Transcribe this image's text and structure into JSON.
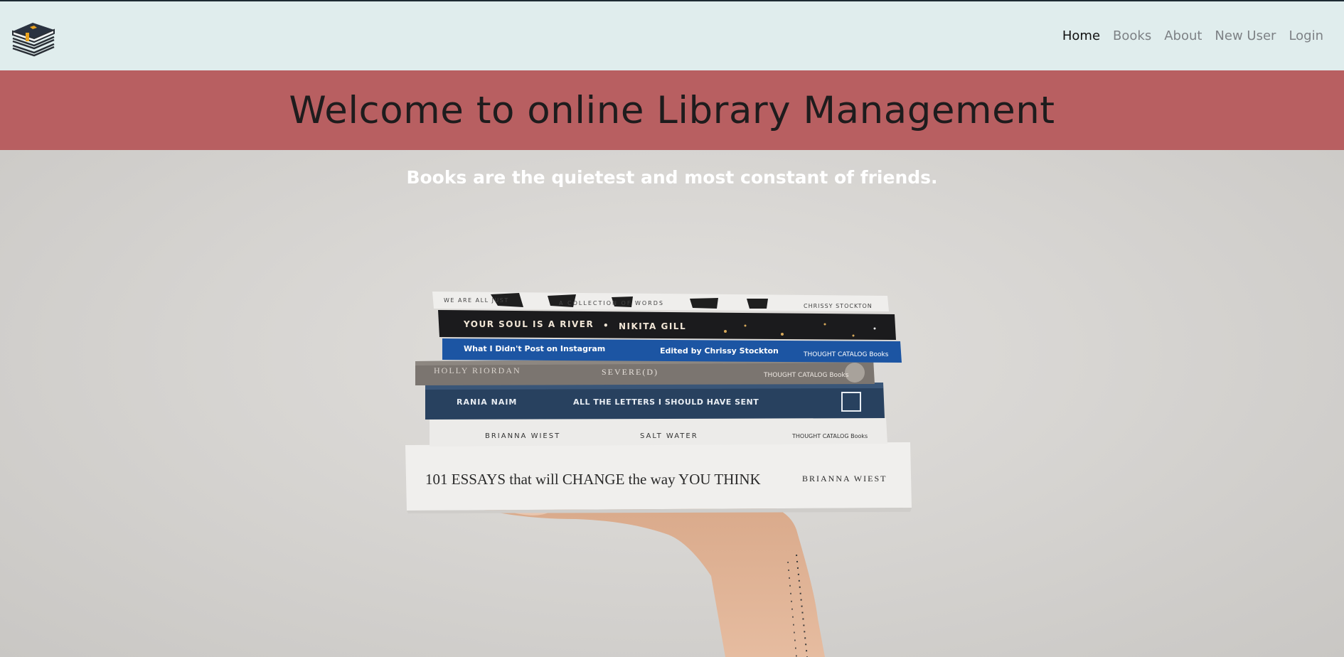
{
  "navbar": {
    "logo_icon": "stacked-books-icon",
    "links": [
      {
        "label": "Home",
        "active": true
      },
      {
        "label": "Books",
        "active": false
      },
      {
        "label": "About",
        "active": false
      },
      {
        "label": "New User",
        "active": false
      },
      {
        "label": "Login",
        "active": false
      }
    ]
  },
  "hero": {
    "title": "Welcome to online Library Management",
    "subtitle": "Books are the quietest and most constant of friends."
  },
  "photo": {
    "books": [
      {
        "left": "WE ARE ALL JUST",
        "mid": "A COLLECTION OF WORDS",
        "right": "CHRISSY STOCKTON"
      },
      {
        "left": "YOUR SOUL IS A RIVER",
        "mid": "•",
        "right": "NIKITA GILL"
      },
      {
        "left": "What I Didn't Post on Instagram",
        "mid": "Edited by Chrissy Stockton",
        "right": "THOUGHT CATALOG Books"
      },
      {
        "left": "HOLLY RIORDAN",
        "mid": "SEVERE(D)",
        "right": "THOUGHT CATALOG Books"
      },
      {
        "left": "RANIA NAIM",
        "mid": "ALL THE LETTERS I SHOULD HAVE SENT",
        "right": ""
      },
      {
        "left": "BRIANNA WIEST",
        "mid": "SALT WATER",
        "right": "THOUGHT CATALOG Books"
      },
      {
        "left": "101 ESSAYS that will CHANGE the way YOU THINK",
        "mid": "",
        "right": "BRIANNA WIEST"
      }
    ]
  },
  "colors": {
    "navbar_bg": "#e0eded",
    "banner_bg": "#b85f61",
    "title_text": "#1e1c1d",
    "subtitle_text": "#ffffff",
    "nav_active": "#111111",
    "nav_inactive": "#7d8185"
  }
}
